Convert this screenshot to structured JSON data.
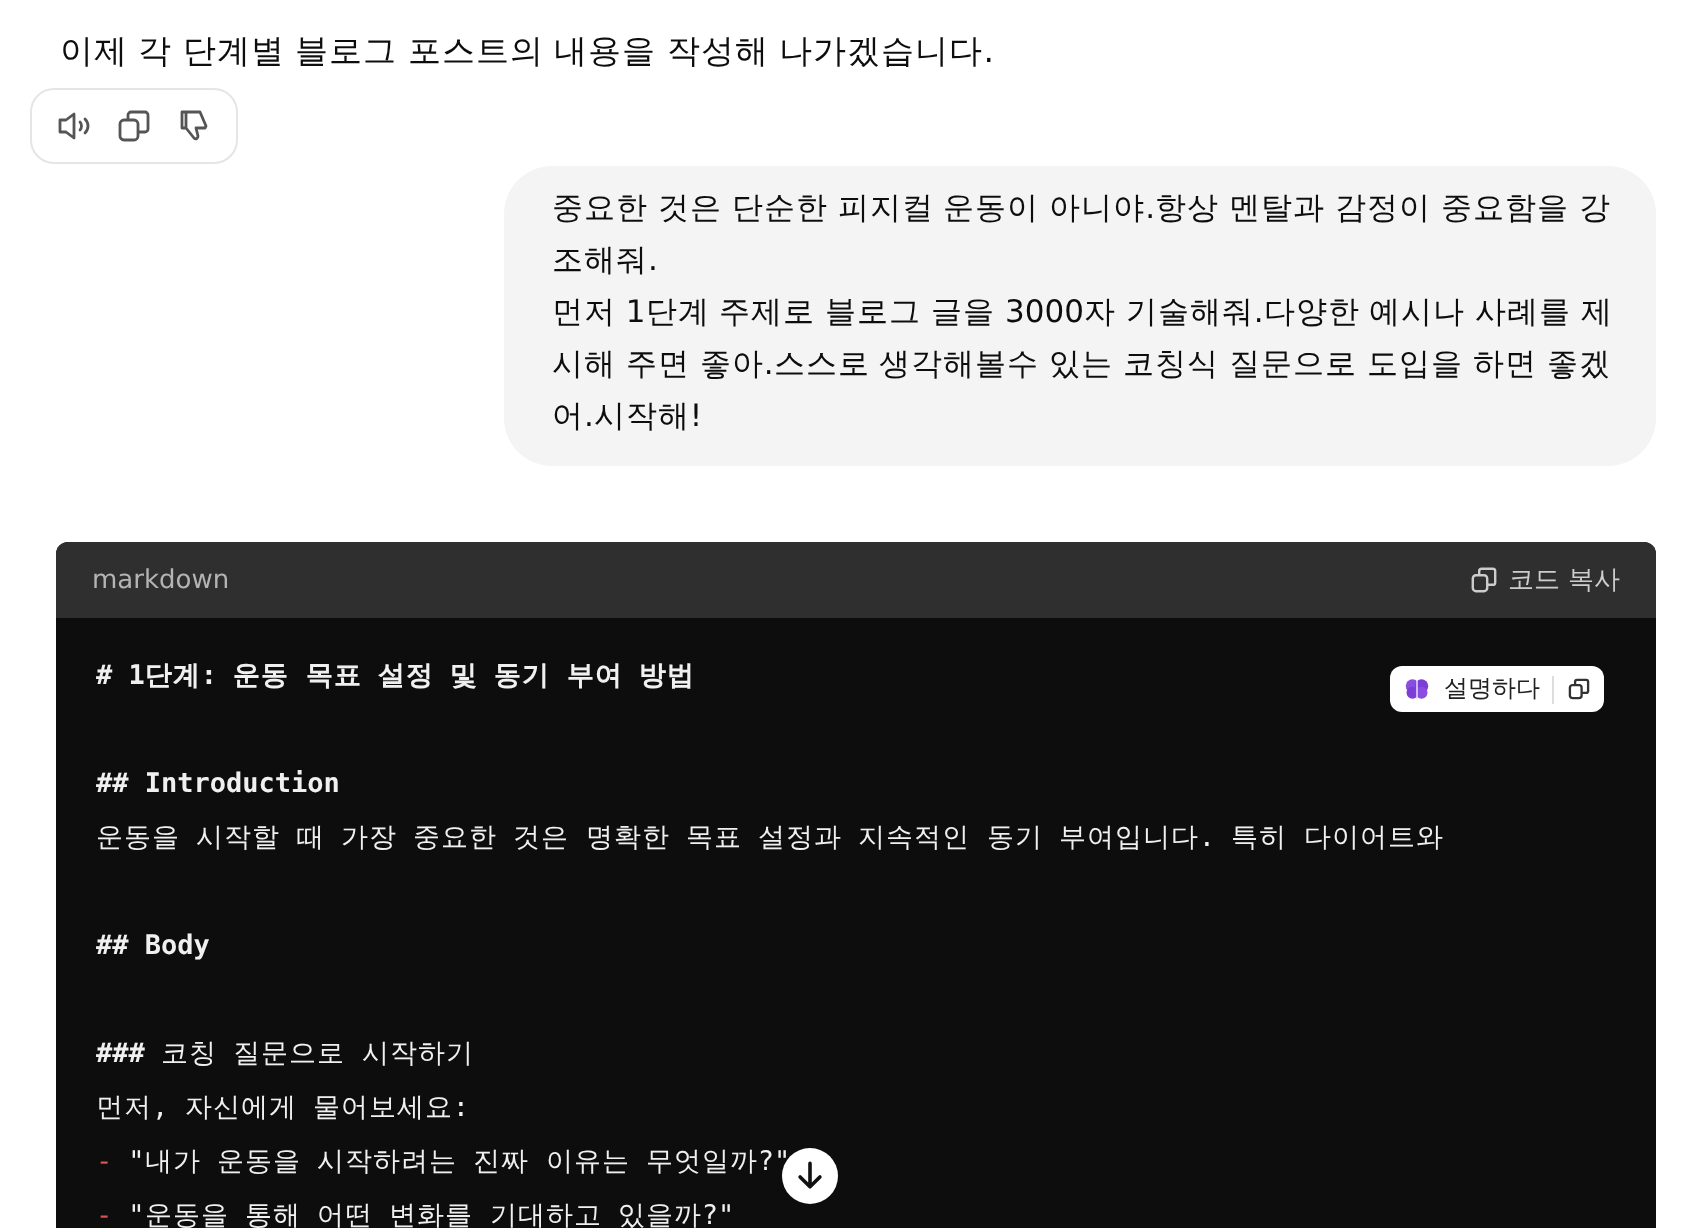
{
  "assistant_message": {
    "text": "이제 각 단계별 블로그 포스트의 내용을 작성해 나가겠습니다."
  },
  "user_message": {
    "lines": [
      "중요한 것은 단순한 피지컬 운동이 아니야.항상 멘탈과 감정이 중요함을 강조해줘.",
      "먼저 1단계 주제로 블로그 글을 3000자 기술해줘.다양한 예시나 사례를 제시해 주면 좋아.스스로 생각해볼수 있는 코칭식 질문으로 도입을 하면 좋겠어.시작해!"
    ]
  },
  "code_block": {
    "language": "markdown",
    "copy_label": "코드 복사",
    "explain_label": "설명하다",
    "lines": [
      {
        "kind": "heading",
        "text": "# 1단계: 운동 목표 설정 및 동기 부여 방법"
      },
      {
        "kind": "blank"
      },
      {
        "kind": "heading",
        "text": "## Introduction"
      },
      {
        "kind": "text",
        "text": "운동을 시작할 때 가장 중요한 것은 명확한 목표 설정과 지속적인 동기 부여입니다. 특히 다이어트와"
      },
      {
        "kind": "blank"
      },
      {
        "kind": "heading",
        "text": "## Body"
      },
      {
        "kind": "blank"
      },
      {
        "kind": "text",
        "text": "**###** 코칭 질문으로 시작하기"
      },
      {
        "kind": "text",
        "text": "먼저, 자신에게 물어보세요:"
      },
      {
        "kind": "list",
        "marker": "-",
        "text": "\"내가 운동을 시작하려는 진짜 이유는 무엇일까?\""
      },
      {
        "kind": "list",
        "marker": "-",
        "text": "\"운동을 통해 어떤 변화를 기대하고 있을까?\""
      }
    ]
  }
}
